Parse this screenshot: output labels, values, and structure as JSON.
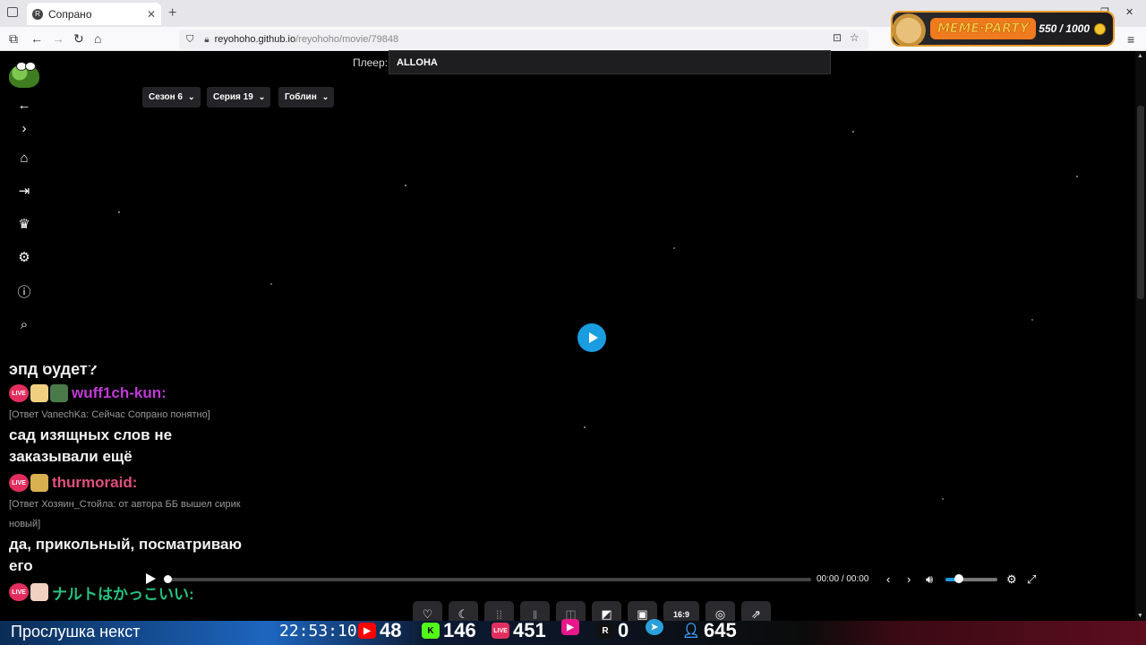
{
  "browser": {
    "tab_title": "Сопрано",
    "tab_favicon": "R",
    "url_host": "reyohoho.github.io",
    "url_path": "/reyohoho/movie/79848"
  },
  "meme_party": {
    "label": "MEME·PARTY",
    "score": "550 / 1000"
  },
  "page": {
    "player_label": "Плеер:",
    "player_value": "ALLOHA",
    "season": "Сезон 6",
    "episode": "Серия 19",
    "voiceover": "Гоблин"
  },
  "sidebar": {
    "icons": [
      "frog-logo",
      "back-arrow-icon",
      "chevron-right-icon",
      "home-icon",
      "login-icon",
      "trophy-icon",
      "gear-icon",
      "info-icon",
      "search-icon"
    ]
  },
  "chat": {
    "cut_line": "эпд будет?",
    "messages": [
      {
        "user": "wuff1ch-kun:",
        "color": "#c13ad6",
        "reply": "[Ответ VanechKa: Сейчас Сопрано понятно]",
        "text_lines": [
          "сад изящных слов не",
          "заказывали ещё"
        ]
      },
      {
        "user": "thurmoraid:",
        "color": "#e0507a",
        "reply_lines": [
          "[Ответ Хозяин_Стойла: от автора ББ вышел сирик",
          "новый]"
        ],
        "text_lines": [
          "да, прикольный, посматриваю",
          "его"
        ]
      },
      {
        "user": "ナルトはかっこいい:",
        "color": "#27c27e"
      }
    ]
  },
  "video": {
    "time_current": "00:00",
    "time_sep": "/",
    "time_total": "00:00",
    "progress": 0,
    "volume": 0.25,
    "aspect_label": "16:9"
  },
  "ticker": {
    "text": "Прослушка некст",
    "clock": "22:53:10",
    "youtube": "48",
    "kick": "146",
    "vk_live": "451",
    "rutube": "0",
    "rumble": "R",
    "telegram_icon": "telegram-icon",
    "viewers": "645"
  },
  "colors": {
    "accent": "#1a9de0",
    "live_badge": "#e22e5e"
  }
}
